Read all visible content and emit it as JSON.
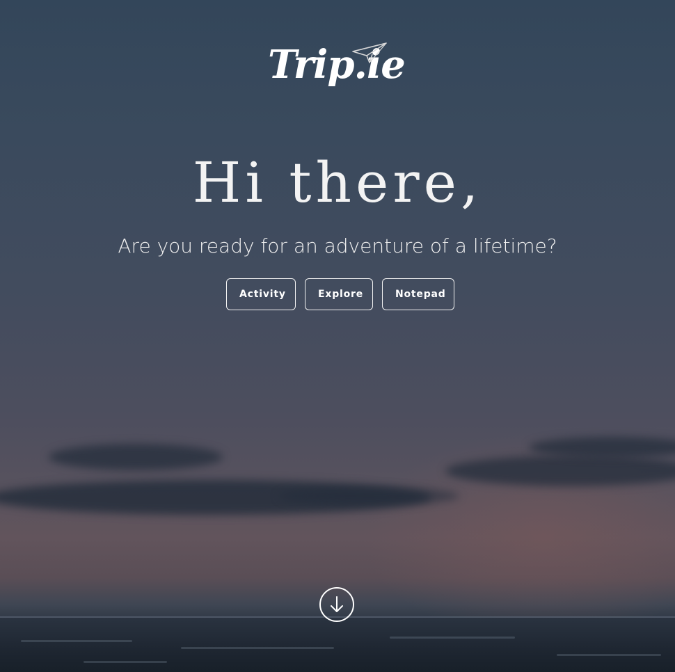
{
  "brand": {
    "logo_text": "Trip.ie",
    "logo_icon": "paper-plane-icon"
  },
  "hero": {
    "headline": "Hi there,",
    "subtitle": "Are you ready for an adventure of a lifetime?",
    "buttons": [
      {
        "label": "Activity"
      },
      {
        "label": "Explore"
      },
      {
        "label": "Notepad"
      }
    ],
    "scroll_icon": "arrow-down-circle-icon"
  },
  "colors": {
    "text": "#ffffff",
    "button_border": "#f2f2f2",
    "sky_top": "#33465a",
    "sky_dusk": "#62545c",
    "sea": "#1f2833"
  }
}
